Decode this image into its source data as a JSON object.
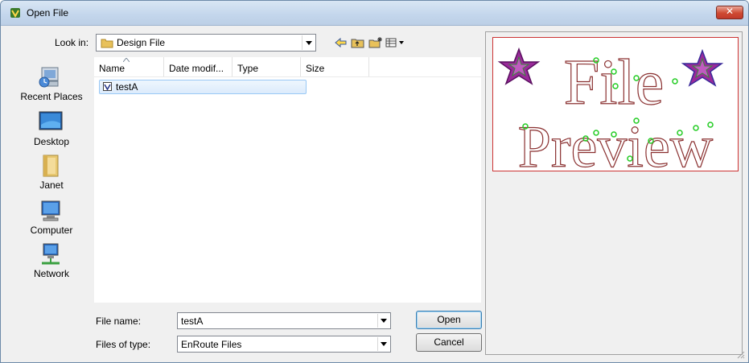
{
  "window": {
    "title": "Open File"
  },
  "look_in": {
    "label": "Look in:",
    "value": "Design File"
  },
  "places": [
    {
      "label": "Recent Places",
      "icon": "recent-places-icon"
    },
    {
      "label": "Desktop",
      "icon": "desktop-icon"
    },
    {
      "label": "Janet",
      "icon": "user-folder-icon"
    },
    {
      "label": "Computer",
      "icon": "computer-icon"
    },
    {
      "label": "Network",
      "icon": "network-icon"
    }
  ],
  "columns": [
    "Name",
    "Date modif...",
    "Type",
    "Size"
  ],
  "files": [
    {
      "name": "testA"
    }
  ],
  "file_name": {
    "label": "File name:",
    "value": "testA"
  },
  "file_type": {
    "label": "Files of type:",
    "value": "EnRoute Files"
  },
  "buttons": {
    "open": "Open",
    "cancel": "Cancel"
  },
  "preview": {
    "line1": "File",
    "line2": "Preview"
  },
  "colors": {
    "accent": "#3c7fb1",
    "preview_border": "#cc3333",
    "preview_text": "#8a3030",
    "star_fill": "#9a2a9a"
  }
}
